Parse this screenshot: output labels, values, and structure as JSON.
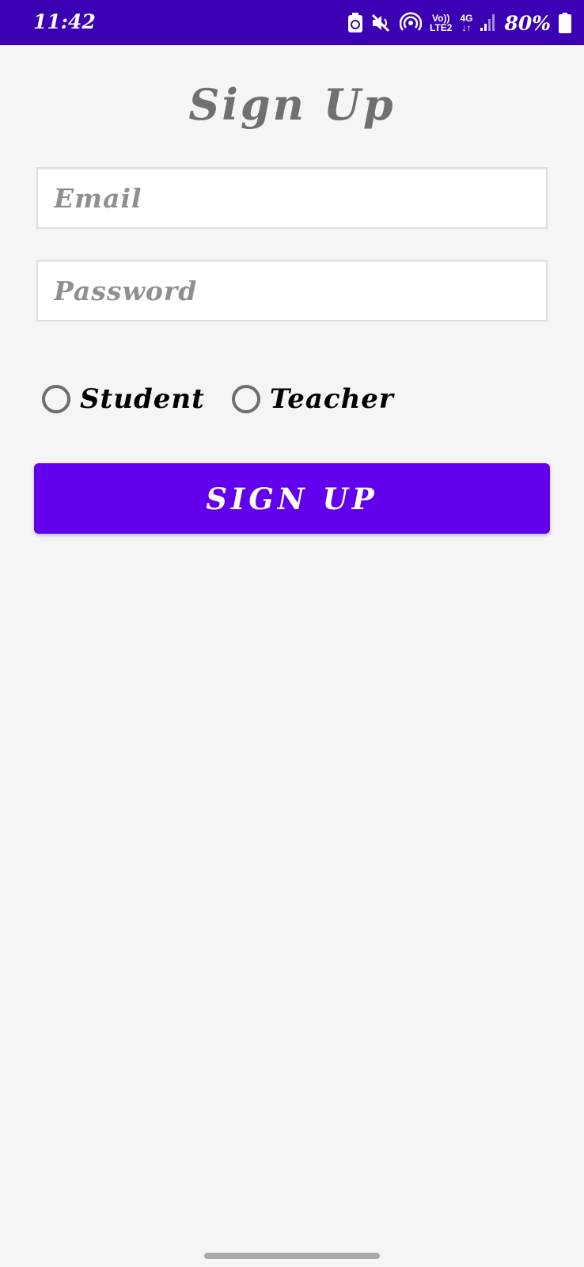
{
  "status_bar": {
    "time": "11:42",
    "icons": [
      "battery-saver-icon",
      "mute-icon",
      "hotspot-icon",
      "volte-icon",
      "4g-data-icon",
      "signal-icon",
      "battery-icon"
    ],
    "volte_top": "Vo))",
    "volte_bottom": "LTE2",
    "net_top": "4G",
    "net_bottom": "↓↑",
    "battery_percent": "80%"
  },
  "page": {
    "title": "Sign Up"
  },
  "form": {
    "email_placeholder": "Email",
    "password_placeholder": "Password",
    "role_options": [
      {
        "label": "Student",
        "selected": false
      },
      {
        "label": "Teacher",
        "selected": false
      }
    ],
    "submit_label": "SIGN UP"
  },
  "colors": {
    "status_bar": "#3b00b3",
    "accent": "#6200ee",
    "background": "#f5f5f5",
    "title": "#707070"
  }
}
